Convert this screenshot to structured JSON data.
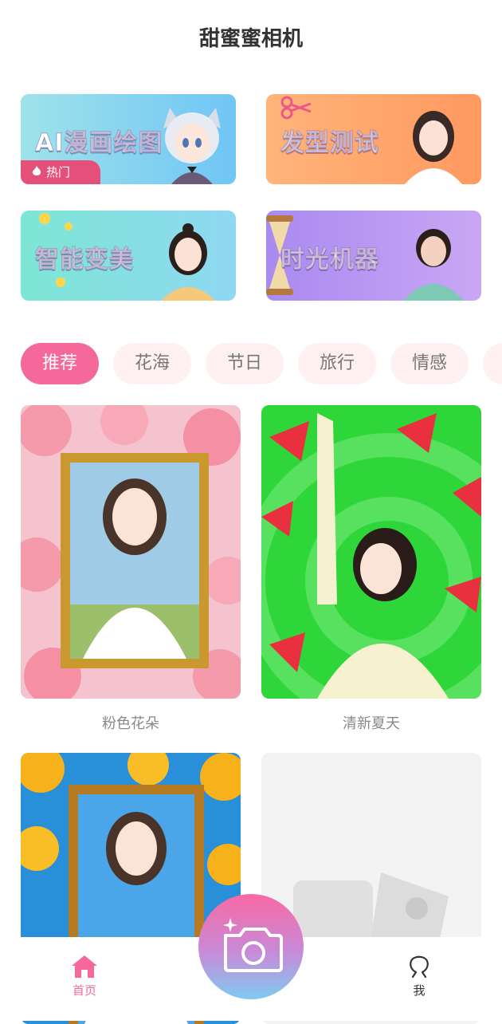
{
  "app": {
    "title": "甜蜜蜜相机"
  },
  "features": [
    {
      "label": "AI漫画绘图",
      "badge": "热门"
    },
    {
      "label": "发型测试"
    },
    {
      "label": "智能变美"
    },
    {
      "label": "时光机器"
    }
  ],
  "tabs": [
    {
      "label": "推荐",
      "active": true
    },
    {
      "label": "花海"
    },
    {
      "label": "节日"
    },
    {
      "label": "旅行"
    },
    {
      "label": "情感"
    }
  ],
  "templates": [
    {
      "name": "粉色花朵"
    },
    {
      "name": "清新夏天"
    },
    {
      "name": ""
    },
    {
      "name": ""
    }
  ],
  "nav": {
    "home": "首页",
    "me": "我"
  },
  "colors": {
    "accent": "#f4699a",
    "tab_bg": "#fff0f2",
    "hot_badge": "#e5507a"
  },
  "icons": [
    "flame-icon",
    "home-icon",
    "person-icon",
    "camera-icon",
    "sparkle-icon"
  ]
}
